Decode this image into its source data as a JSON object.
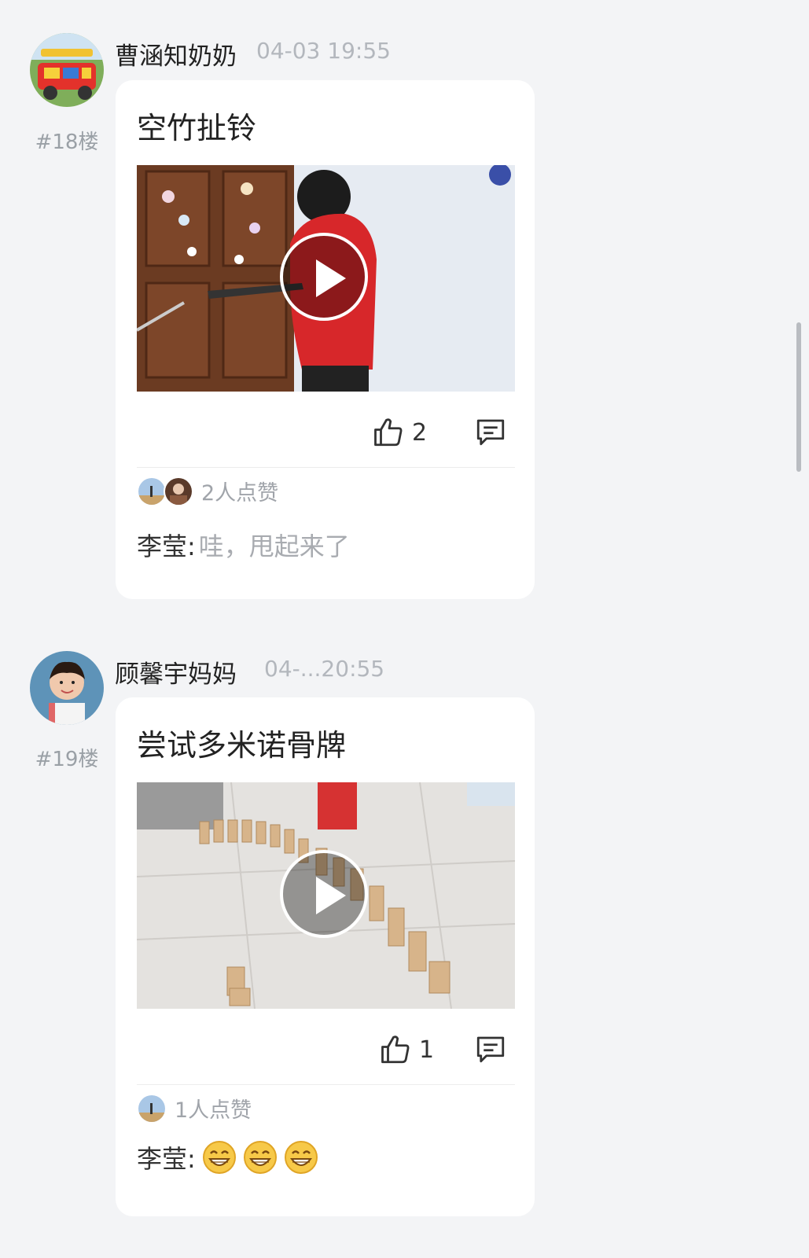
{
  "posts": [
    {
      "author": "曹涵知奶奶",
      "time": "04-03 19:55",
      "floor": "#18楼",
      "title": "空竹扯铃",
      "likes": "2",
      "likes_summary": "2人点赞",
      "comment": {
        "name": "李莹:",
        "text": "哇，甩起来了"
      }
    },
    {
      "author": "顾馨宇妈妈",
      "time": "04-...20:55",
      "floor": "#19楼",
      "title": "尝试多米诺骨牌",
      "likes": "1",
      "likes_summary": "1人点赞",
      "comment": {
        "name": "李莹:",
        "emoji": [
          "grin-emoji",
          "grin-emoji",
          "grin-emoji"
        ]
      }
    }
  ],
  "icons": {
    "like": "thumbs-up-icon",
    "comment": "comment-icon",
    "play": "play-icon"
  },
  "colors": {
    "background": "#f3f4f6",
    "card": "#ffffff",
    "muted_text": "#a8abb0"
  }
}
